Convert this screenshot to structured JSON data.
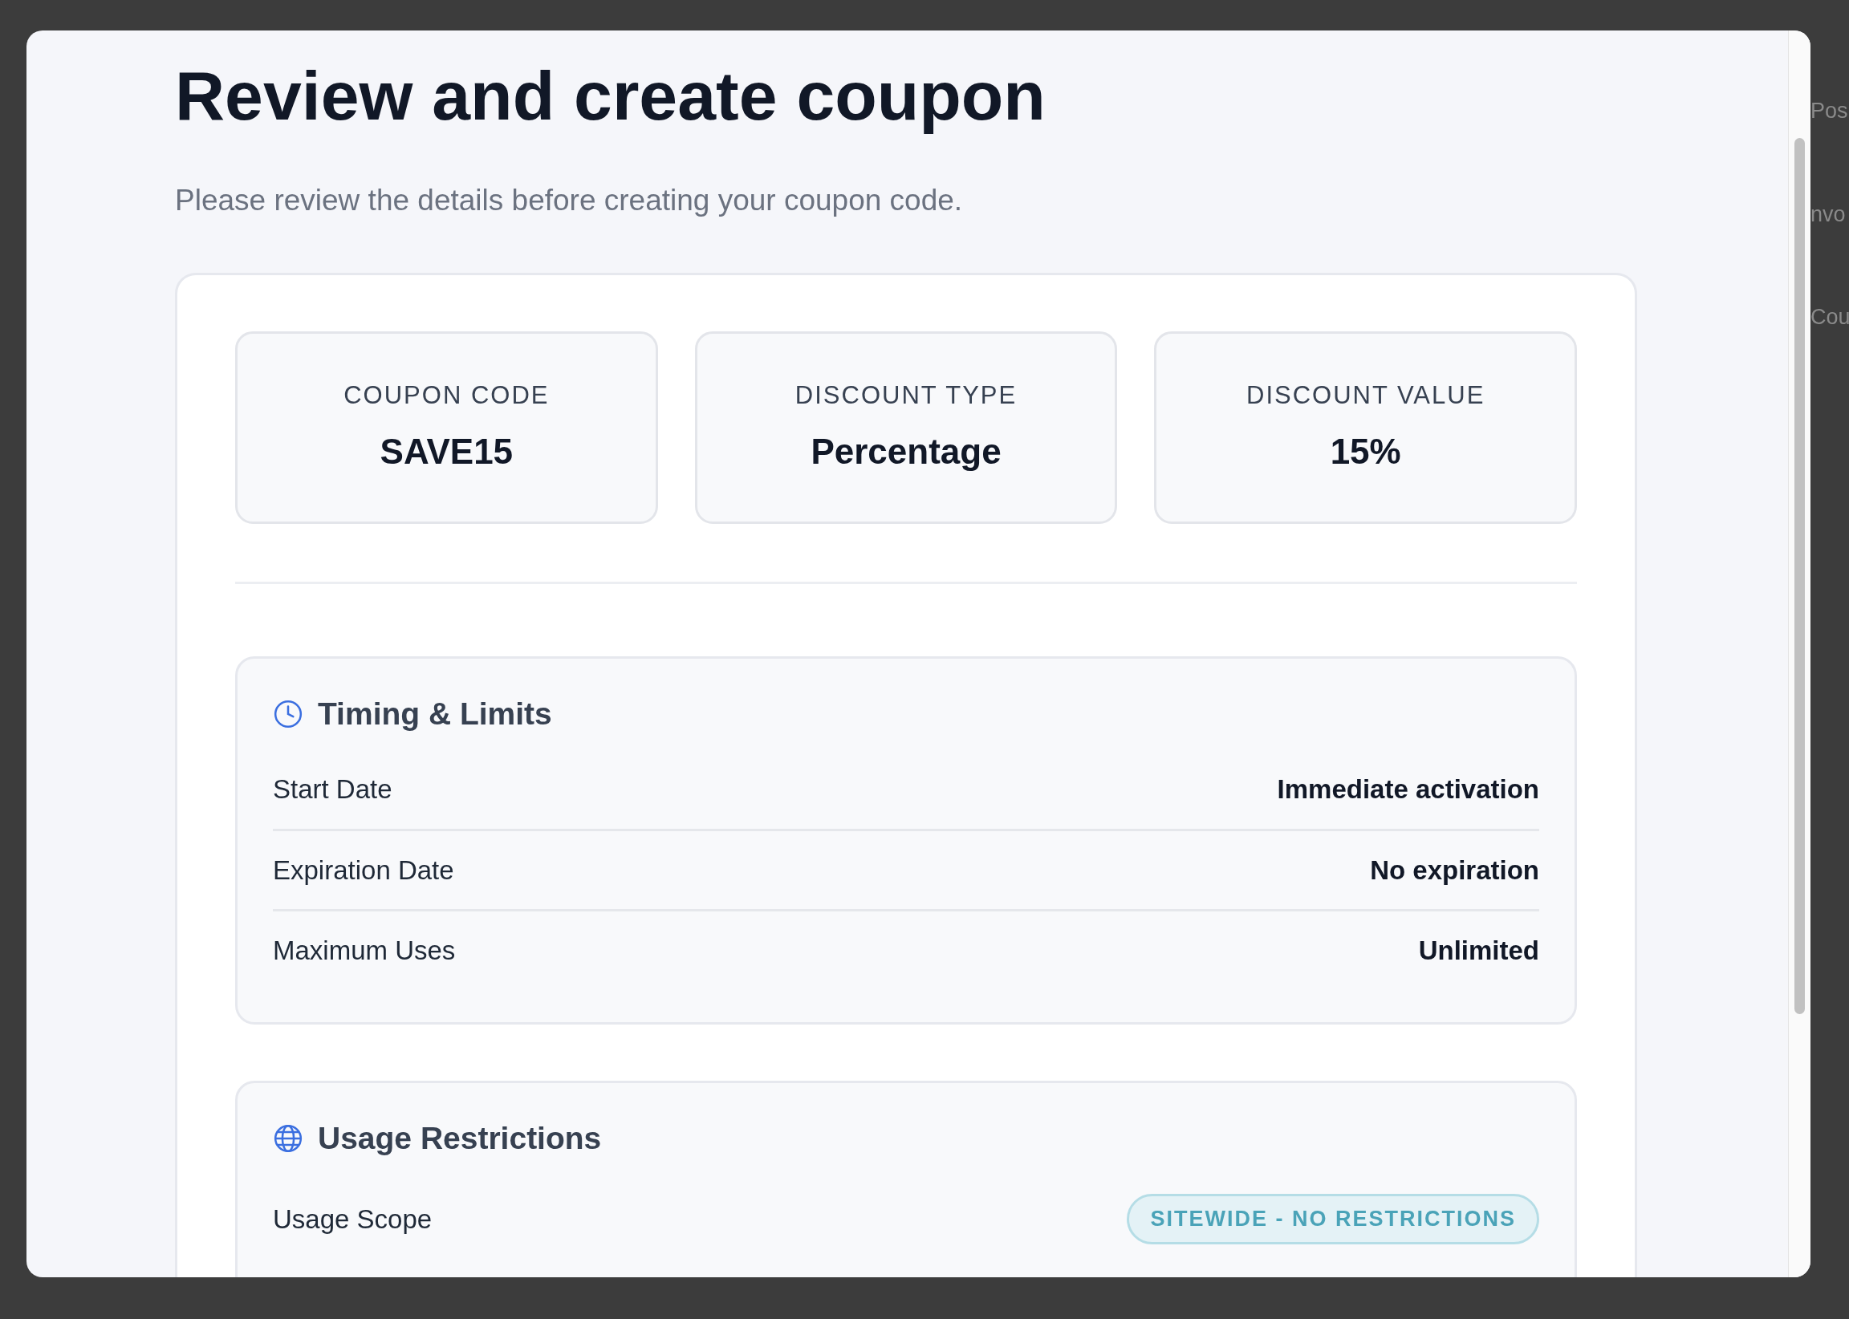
{
  "backdrop": {
    "side_texts": [
      "Pos",
      "nvo",
      "Cou"
    ]
  },
  "title": "Review and create coupon",
  "subtitle": "Please review the details before creating your coupon code.",
  "summary": [
    {
      "label": "COUPON CODE",
      "value": "SAVE15"
    },
    {
      "label": "DISCOUNT TYPE",
      "value": "Percentage"
    },
    {
      "label": "DISCOUNT VALUE",
      "value": "15%"
    }
  ],
  "sections": [
    {
      "title": "Timing & Limits",
      "rows": [
        {
          "kind": "text",
          "label": "Start Date",
          "value": "Immediate activation"
        },
        {
          "kind": "text",
          "label": "Expiration Date",
          "value": "No expiration"
        },
        {
          "kind": "text",
          "label": "Maximum Uses",
          "value": "Unlimited"
        }
      ]
    },
    {
      "title": "Usage Restrictions",
      "rows": [
        {
          "kind": "badge",
          "label": "Usage Scope",
          "value": "SITEWIDE - NO RESTRICTIONS"
        }
      ]
    }
  ]
}
